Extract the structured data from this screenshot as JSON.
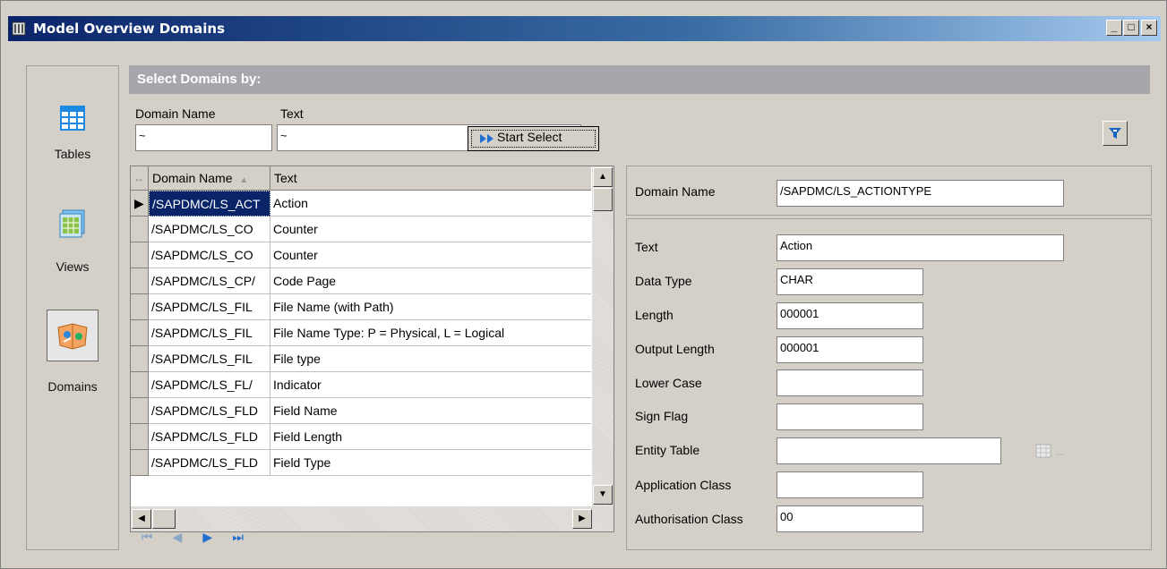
{
  "window": {
    "title": "Model Overview Domains",
    "controls": [
      "_",
      "□",
      "×"
    ]
  },
  "nav": [
    {
      "label": "Tables",
      "icon": "table-icon"
    },
    {
      "label": "Views",
      "icon": "view-icon"
    },
    {
      "label": "Domains",
      "icon": "domains-icon",
      "active": true
    }
  ],
  "selection": {
    "header": "Select Domains by:",
    "domain_name_label": "Domain Name",
    "domain_name_value": "~",
    "text_label": "Text",
    "text_value": "~",
    "start_button": "Start Select"
  },
  "grid": {
    "columns": [
      "Domain Name",
      "Text"
    ],
    "rows": [
      {
        "domain": "/SAPDMC/LS_ACT",
        "text": "Action",
        "selected": true
      },
      {
        "domain": "/SAPDMC/LS_CO",
        "text": "Counter"
      },
      {
        "domain": "/SAPDMC/LS_CO",
        "text": "Counter"
      },
      {
        "domain": "/SAPDMC/LS_CP/",
        "text": "Code Page"
      },
      {
        "domain": "/SAPDMC/LS_FIL",
        "text": "File Name (with Path)"
      },
      {
        "domain": "/SAPDMC/LS_FIL",
        "text": "File Name Type: P = Physical, L = Logical"
      },
      {
        "domain": "/SAPDMC/LS_FIL",
        "text": "File type"
      },
      {
        "domain": "/SAPDMC/LS_FL/",
        "text": "Indicator"
      },
      {
        "domain": "/SAPDMC/LS_FLD",
        "text": "Field Name"
      },
      {
        "domain": "/SAPDMC/LS_FLD",
        "text": "Field Length"
      },
      {
        "domain": "/SAPDMC/LS_FLD",
        "text": "Field Type"
      }
    ]
  },
  "detail": {
    "domain_name_label": "Domain Name",
    "domain_name_value": "/SAPDMC/LS_ACTIONTYPE",
    "fields": [
      {
        "label": "Text",
        "value": "Action"
      },
      {
        "label": "Data Type",
        "value": "CHAR"
      },
      {
        "label": "Length",
        "value": "000001"
      },
      {
        "label": "Output Length",
        "value": "000001"
      },
      {
        "label": "Lower Case",
        "value": ""
      },
      {
        "label": "Sign Flag",
        "value": ""
      },
      {
        "label": "Entity Table",
        "value": ""
      },
      {
        "label": "Application Class",
        "value": ""
      },
      {
        "label": "Authorisation Class",
        "value": "00"
      }
    ],
    "entity_ellipsis": "..."
  },
  "colors": {
    "title_start": "#0a246a",
    "title_end": "#a6caf0",
    "selection_blue": "#0a246a",
    "pager_blue": "#1f6fd0"
  }
}
